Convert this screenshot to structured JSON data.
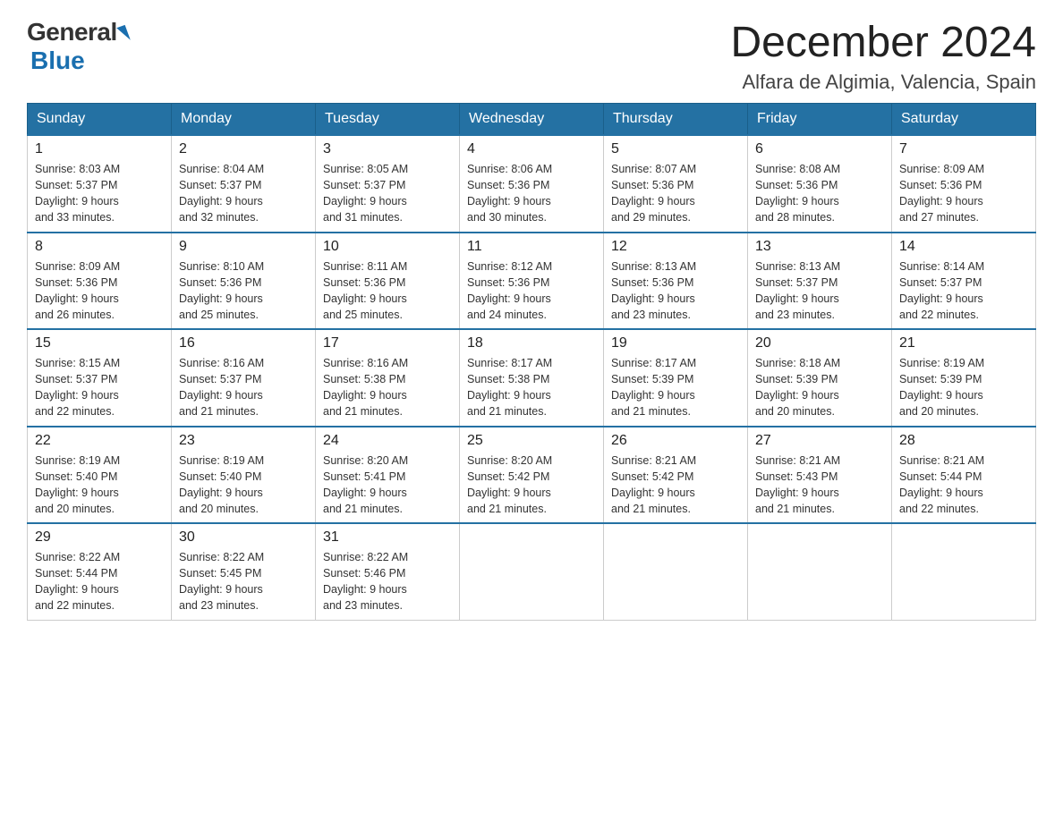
{
  "header": {
    "logo_general": "General",
    "logo_blue": "Blue",
    "month_title": "December 2024",
    "location": "Alfara de Algimia, Valencia, Spain"
  },
  "days_of_week": [
    "Sunday",
    "Monday",
    "Tuesday",
    "Wednesday",
    "Thursday",
    "Friday",
    "Saturday"
  ],
  "weeks": [
    [
      {
        "day": "1",
        "sunrise": "8:03 AM",
        "sunset": "5:37 PM",
        "daylight": "9 hours and 33 minutes."
      },
      {
        "day": "2",
        "sunrise": "8:04 AM",
        "sunset": "5:37 PM",
        "daylight": "9 hours and 32 minutes."
      },
      {
        "day": "3",
        "sunrise": "8:05 AM",
        "sunset": "5:37 PM",
        "daylight": "9 hours and 31 minutes."
      },
      {
        "day": "4",
        "sunrise": "8:06 AM",
        "sunset": "5:36 PM",
        "daylight": "9 hours and 30 minutes."
      },
      {
        "day": "5",
        "sunrise": "8:07 AM",
        "sunset": "5:36 PM",
        "daylight": "9 hours and 29 minutes."
      },
      {
        "day": "6",
        "sunrise": "8:08 AM",
        "sunset": "5:36 PM",
        "daylight": "9 hours and 28 minutes."
      },
      {
        "day": "7",
        "sunrise": "8:09 AM",
        "sunset": "5:36 PM",
        "daylight": "9 hours and 27 minutes."
      }
    ],
    [
      {
        "day": "8",
        "sunrise": "8:09 AM",
        "sunset": "5:36 PM",
        "daylight": "9 hours and 26 minutes."
      },
      {
        "day": "9",
        "sunrise": "8:10 AM",
        "sunset": "5:36 PM",
        "daylight": "9 hours and 25 minutes."
      },
      {
        "day": "10",
        "sunrise": "8:11 AM",
        "sunset": "5:36 PM",
        "daylight": "9 hours and 25 minutes."
      },
      {
        "day": "11",
        "sunrise": "8:12 AM",
        "sunset": "5:36 PM",
        "daylight": "9 hours and 24 minutes."
      },
      {
        "day": "12",
        "sunrise": "8:13 AM",
        "sunset": "5:36 PM",
        "daylight": "9 hours and 23 minutes."
      },
      {
        "day": "13",
        "sunrise": "8:13 AM",
        "sunset": "5:37 PM",
        "daylight": "9 hours and 23 minutes."
      },
      {
        "day": "14",
        "sunrise": "8:14 AM",
        "sunset": "5:37 PM",
        "daylight": "9 hours and 22 minutes."
      }
    ],
    [
      {
        "day": "15",
        "sunrise": "8:15 AM",
        "sunset": "5:37 PM",
        "daylight": "9 hours and 22 minutes."
      },
      {
        "day": "16",
        "sunrise": "8:16 AM",
        "sunset": "5:37 PM",
        "daylight": "9 hours and 21 minutes."
      },
      {
        "day": "17",
        "sunrise": "8:16 AM",
        "sunset": "5:38 PM",
        "daylight": "9 hours and 21 minutes."
      },
      {
        "day": "18",
        "sunrise": "8:17 AM",
        "sunset": "5:38 PM",
        "daylight": "9 hours and 21 minutes."
      },
      {
        "day": "19",
        "sunrise": "8:17 AM",
        "sunset": "5:39 PM",
        "daylight": "9 hours and 21 minutes."
      },
      {
        "day": "20",
        "sunrise": "8:18 AM",
        "sunset": "5:39 PM",
        "daylight": "9 hours and 20 minutes."
      },
      {
        "day": "21",
        "sunrise": "8:19 AM",
        "sunset": "5:39 PM",
        "daylight": "9 hours and 20 minutes."
      }
    ],
    [
      {
        "day": "22",
        "sunrise": "8:19 AM",
        "sunset": "5:40 PM",
        "daylight": "9 hours and 20 minutes."
      },
      {
        "day": "23",
        "sunrise": "8:19 AM",
        "sunset": "5:40 PM",
        "daylight": "9 hours and 20 minutes."
      },
      {
        "day": "24",
        "sunrise": "8:20 AM",
        "sunset": "5:41 PM",
        "daylight": "9 hours and 21 minutes."
      },
      {
        "day": "25",
        "sunrise": "8:20 AM",
        "sunset": "5:42 PM",
        "daylight": "9 hours and 21 minutes."
      },
      {
        "day": "26",
        "sunrise": "8:21 AM",
        "sunset": "5:42 PM",
        "daylight": "9 hours and 21 minutes."
      },
      {
        "day": "27",
        "sunrise": "8:21 AM",
        "sunset": "5:43 PM",
        "daylight": "9 hours and 21 minutes."
      },
      {
        "day": "28",
        "sunrise": "8:21 AM",
        "sunset": "5:44 PM",
        "daylight": "9 hours and 22 minutes."
      }
    ],
    [
      {
        "day": "29",
        "sunrise": "8:22 AM",
        "sunset": "5:44 PM",
        "daylight": "9 hours and 22 minutes."
      },
      {
        "day": "30",
        "sunrise": "8:22 AM",
        "sunset": "5:45 PM",
        "daylight": "9 hours and 23 minutes."
      },
      {
        "day": "31",
        "sunrise": "8:22 AM",
        "sunset": "5:46 PM",
        "daylight": "9 hours and 23 minutes."
      },
      null,
      null,
      null,
      null
    ]
  ],
  "labels": {
    "sunrise": "Sunrise:",
    "sunset": "Sunset:",
    "daylight": "Daylight:"
  }
}
